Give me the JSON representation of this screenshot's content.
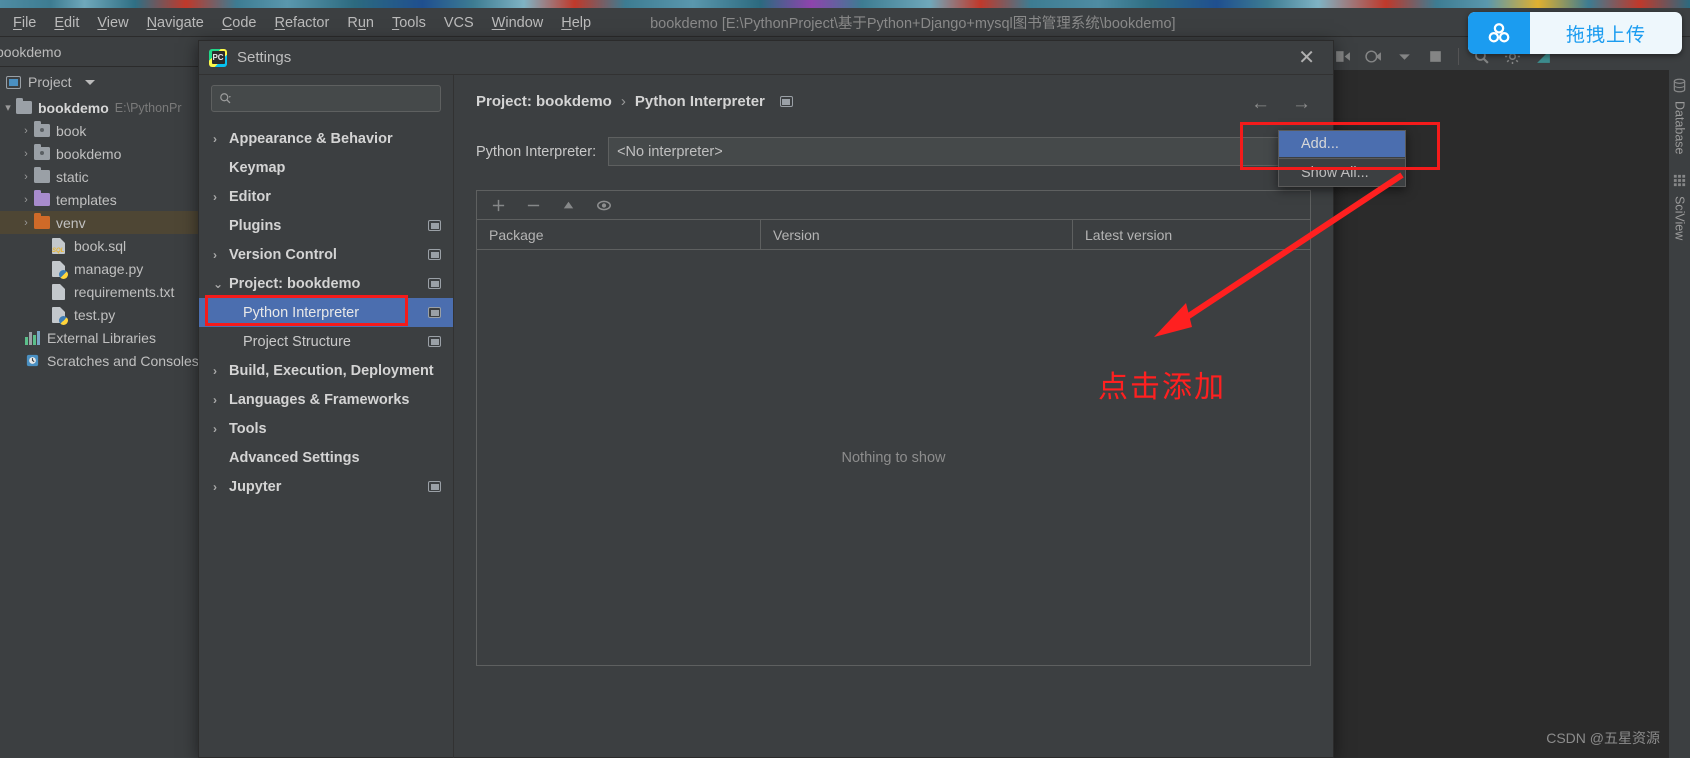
{
  "menubar": {
    "items": [
      {
        "label": "File",
        "mnemonic": "F"
      },
      {
        "label": "Edit",
        "mnemonic": "E"
      },
      {
        "label": "View",
        "mnemonic": "V"
      },
      {
        "label": "Navigate",
        "mnemonic": "N"
      },
      {
        "label": "Code",
        "mnemonic": "C"
      },
      {
        "label": "Refactor",
        "mnemonic": "R"
      },
      {
        "label": "Run",
        "mnemonic": "u"
      },
      {
        "label": "Tools",
        "mnemonic": "T"
      },
      {
        "label": "VCS",
        "mnemonic": ""
      },
      {
        "label": "Window",
        "mnemonic": "W"
      },
      {
        "label": "Help",
        "mnemonic": "H"
      }
    ],
    "window_title": "bookdemo [E:\\PythonProject\\基于Python+Django+mysql图书管理系统\\bookdemo]"
  },
  "upload_widget": {
    "label": "拖拽上传",
    "icon": "cloud-upload-icon",
    "accent": "#1b9cf0"
  },
  "project_panel": {
    "tab_label": "bookdemo",
    "toolbar_title": "Project",
    "tree": [
      {
        "label": "bookdemo",
        "path": "E:\\PythonPr",
        "icon": "folder-grey-icon",
        "arrow": "▾",
        "depth": 0,
        "bold": true,
        "selected": false
      },
      {
        "label": "book",
        "path": "",
        "icon": "folder-module-icon",
        "arrow": "›",
        "depth": 1,
        "bold": false,
        "selected": false
      },
      {
        "label": "bookdemo",
        "path": "",
        "icon": "folder-module-icon",
        "arrow": "›",
        "depth": 1,
        "bold": false,
        "selected": false
      },
      {
        "label": "static",
        "path": "",
        "icon": "folder-grey-icon",
        "arrow": "›",
        "depth": 1,
        "bold": false,
        "selected": false
      },
      {
        "label": "templates",
        "path": "",
        "icon": "folder-purple-icon",
        "arrow": "›",
        "depth": 1,
        "bold": false,
        "selected": false
      },
      {
        "label": "venv",
        "path": "",
        "icon": "folder-orange-icon",
        "arrow": "›",
        "depth": 1,
        "bold": false,
        "selected": true
      },
      {
        "label": "book.sql",
        "path": "",
        "icon": "sql-file-icon",
        "arrow": "",
        "depth": 2,
        "bold": false,
        "selected": false
      },
      {
        "label": "manage.py",
        "path": "",
        "icon": "python-file-icon",
        "arrow": "",
        "depth": 2,
        "bold": false,
        "selected": false
      },
      {
        "label": "requirements.txt",
        "path": "",
        "icon": "text-file-icon",
        "arrow": "",
        "depth": 2,
        "bold": false,
        "selected": false
      },
      {
        "label": "test.py",
        "path": "",
        "icon": "python-file-icon",
        "arrow": "",
        "depth": 2,
        "bold": false,
        "selected": false
      },
      {
        "label": "External Libraries",
        "path": "",
        "icon": "libraries-icon",
        "arrow": "",
        "depth": 0.5,
        "bold": false,
        "selected": false
      },
      {
        "label": "Scratches and Consoles",
        "path": "",
        "icon": "scratches-icon",
        "arrow": "",
        "depth": 0.5,
        "bold": false,
        "selected": false
      }
    ]
  },
  "settings_dialog": {
    "title": "Settings",
    "close_label": "✕",
    "search": {
      "value": "",
      "placeholder": ""
    },
    "nav": [
      {
        "label": "Appearance & Behavior",
        "arrow": "›",
        "bold": true,
        "indent": false,
        "selected": false,
        "mini": false
      },
      {
        "label": "Keymap",
        "arrow": "",
        "bold": true,
        "indent": false,
        "selected": false,
        "mini": false
      },
      {
        "label": "Editor",
        "arrow": "›",
        "bold": true,
        "indent": false,
        "selected": false,
        "mini": false
      },
      {
        "label": "Plugins",
        "arrow": "",
        "bold": true,
        "indent": false,
        "selected": false,
        "mini": true
      },
      {
        "label": "Version Control",
        "arrow": "›",
        "bold": true,
        "indent": false,
        "selected": false,
        "mini": true
      },
      {
        "label": "Project: bookdemo",
        "arrow": "⌄",
        "bold": true,
        "indent": false,
        "selected": false,
        "mini": true
      },
      {
        "label": "Python Interpreter",
        "arrow": "",
        "bold": false,
        "indent": true,
        "selected": true,
        "mini": true
      },
      {
        "label": "Project Structure",
        "arrow": "",
        "bold": false,
        "indent": true,
        "selected": false,
        "mini": true
      },
      {
        "label": "Build, Execution, Deployment",
        "arrow": "›",
        "bold": true,
        "indent": false,
        "selected": false,
        "mini": false
      },
      {
        "label": "Languages & Frameworks",
        "arrow": "›",
        "bold": true,
        "indent": false,
        "selected": false,
        "mini": false
      },
      {
        "label": "Tools",
        "arrow": "›",
        "bold": true,
        "indent": false,
        "selected": false,
        "mini": false
      },
      {
        "label": "Advanced Settings",
        "arrow": "",
        "bold": true,
        "indent": false,
        "selected": false,
        "mini": false
      },
      {
        "label": "Jupyter",
        "arrow": "›",
        "bold": true,
        "indent": false,
        "selected": false,
        "mini": true
      }
    ],
    "breadcrumb": {
      "root": "Project: bookdemo",
      "separator": "›",
      "leaf": "Python Interpreter"
    },
    "nav_back": "←",
    "nav_forward": "→",
    "interpreter": {
      "label": "Python Interpreter:",
      "value": "<No interpreter>",
      "dropdown_open": true,
      "menu": [
        {
          "label": "Add...",
          "selected": true
        },
        {
          "label": "Show All...",
          "selected": false
        }
      ]
    },
    "packages": {
      "toolbar_icons": [
        "add-package-icon",
        "remove-package-icon",
        "upgrade-package-icon",
        "show-early-releases-icon"
      ],
      "columns": [
        "Package",
        "Version",
        "Latest version"
      ],
      "rows": [],
      "empty_text": "Nothing to show"
    }
  },
  "right_tool_strip": {
    "tabs": [
      {
        "label": "Database",
        "icon": "database-icon"
      },
      {
        "label": "SciView",
        "icon": "sciview-grid-icon"
      }
    ]
  },
  "ide_toolbar_icons": [
    "debug-bug-icon",
    "step-over-icon",
    "run-with-coverage-icon",
    "stop-icon",
    "search-everywhere-icon",
    "settings-icon"
  ],
  "annotations": {
    "callout_text": "点击添加",
    "color": "#ff2020",
    "boxes": [
      "python-interpreter-nav-highlight",
      "add-dropdown-highlight"
    ],
    "arrow": "arrow-pointing-to-add-menu"
  },
  "watermark": "CSDN @五星资源"
}
